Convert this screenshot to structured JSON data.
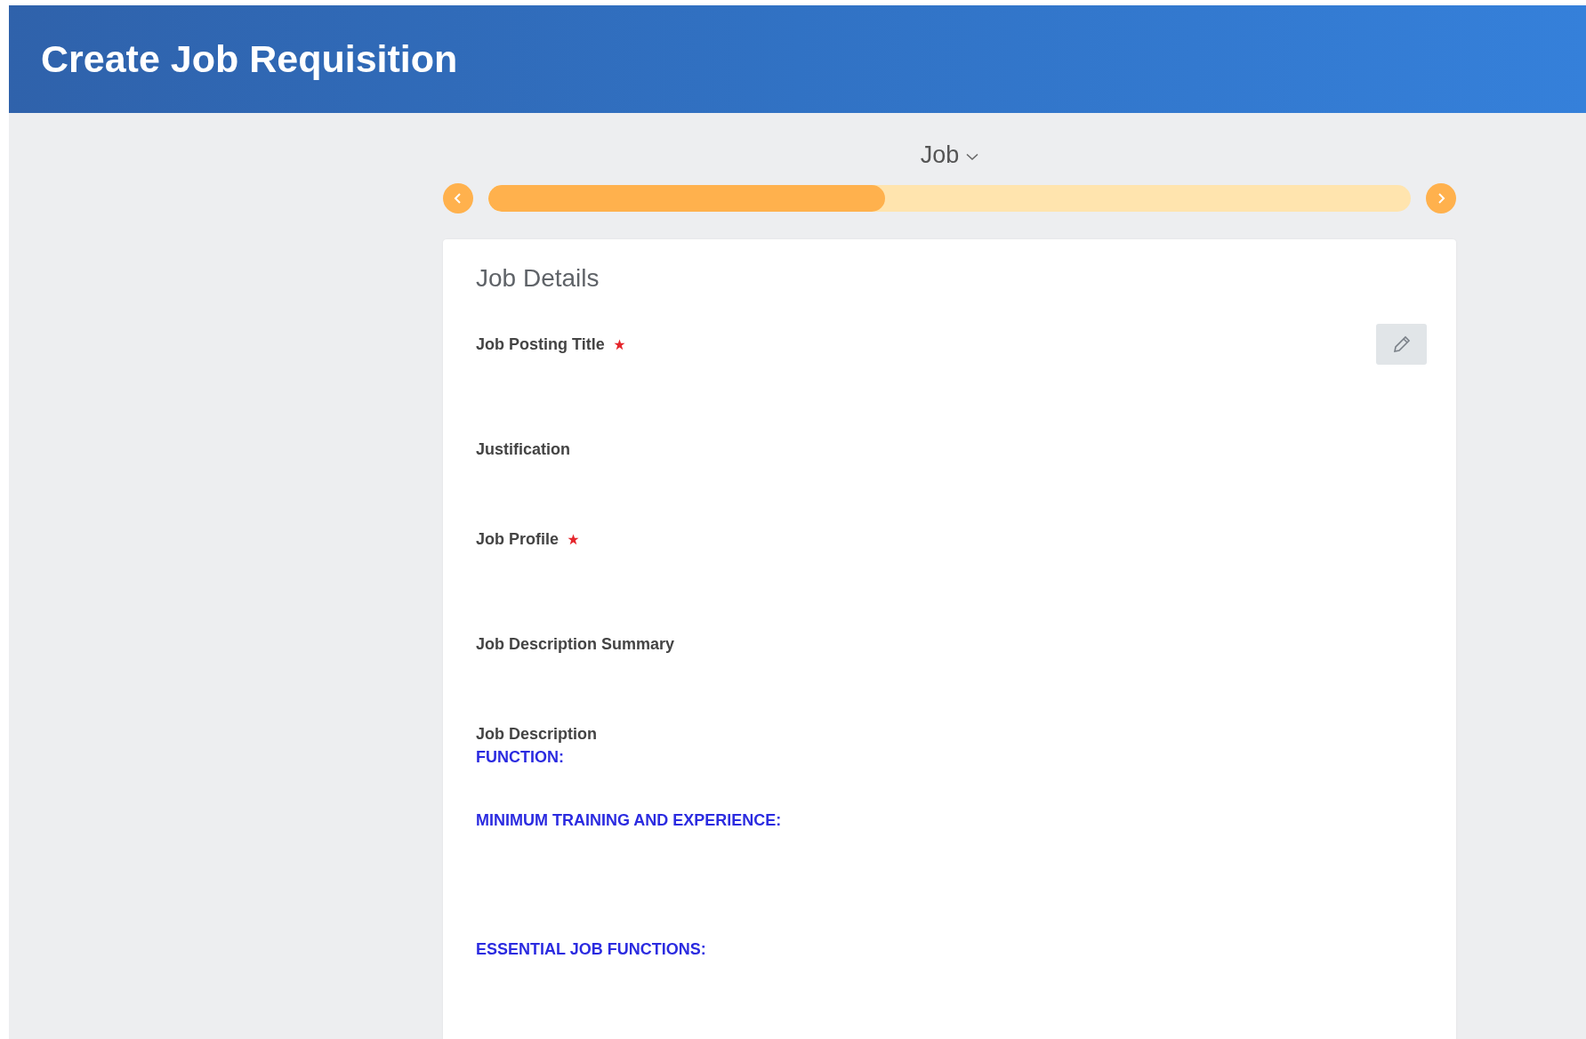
{
  "header": {
    "title": "Create Job Requisition"
  },
  "stepper": {
    "label": "Job",
    "level": 0.43
  },
  "card": {
    "title": "Job Details",
    "fields": [
      {
        "label": "Job Posting Title",
        "required": true
      },
      {
        "label": "Justification",
        "required": false
      },
      {
        "label": "Job Profile",
        "required": true
      },
      {
        "label": "Job Description Summary",
        "required": false
      },
      {
        "label": "Job Description",
        "required": false,
        "sections": [
          "FUNCTION:",
          "MINIMUM TRAINING AND EXPERIENCE:",
          "ESSENTIAL JOB FUNCTIONS:"
        ]
      }
    ]
  }
}
